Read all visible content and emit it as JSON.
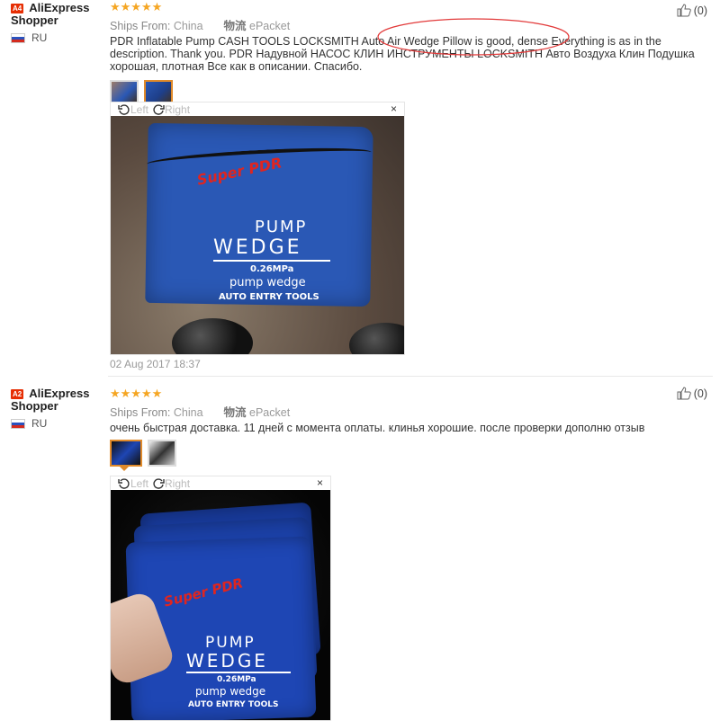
{
  "reviews": [
    {
      "badge": "A4",
      "user_name": "AliExpress",
      "user_name2": "Shopper",
      "country": "RU",
      "stars": "★★★★★",
      "ships_label": "Ships From:",
      "ships_from": "China",
      "logistics_label": "物流",
      "logistics": "ePacket",
      "text": "PDR Inflatable Pump CASH TOOLS LOCKSMITH Auto Air Wedge Pillow is good, dense Everything is as in the description. Thank you. PDR Надувной НАСОС КЛИН ИНСТРУМЕНТЫ LOCKSMITH Авто Воздуха Клин Подушка хорошая, плотная Все как в описании. Спасибо.",
      "helpful": "(0)",
      "viewer": {
        "left": "Left",
        "right": "Right",
        "close": "×"
      },
      "photo": {
        "brand": "Super PDR",
        "line1": "PUMP",
        "line2": "WEDGE",
        "line3": "0.26MPa",
        "line4": "pump wedge",
        "line5": "AUTO ENTRY TOOLS"
      },
      "date": "02 Aug 2017 18:37"
    },
    {
      "badge": "A2",
      "user_name": "AliExpress",
      "user_name2": "Shopper",
      "country": "RU",
      "stars": "★★★★★",
      "ships_label": "Ships From:",
      "ships_from": "China",
      "logistics_label": "物流",
      "logistics": "ePacket",
      "text": "очень быстрая доставка. 11 дней с момента оплаты. клинья хорошие. после проверки дополню отзыв",
      "helpful": "(0)",
      "viewer": {
        "left": "Left",
        "right": "Right",
        "close": "×"
      },
      "photo": {
        "brand": "Super PDR",
        "line1": "PUMP",
        "line2": "WEDGE",
        "line3": "0.26MPa",
        "line4": "pump wedge",
        "line5": "AUTO ENTRY TOOLS"
      }
    }
  ],
  "colors": {
    "accent": "#e62e04",
    "stars": "#f5a623",
    "bag": "#2a58b5",
    "annotation": "#e23a3a"
  }
}
